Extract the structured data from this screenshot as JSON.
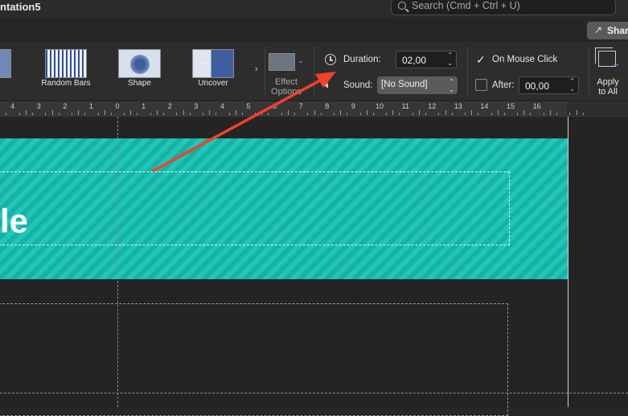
{
  "window": {
    "title": "ntation5"
  },
  "search": {
    "placeholder": "Search (Cmd + Ctrl + U)"
  },
  "share": {
    "label": "Shar"
  },
  "transitions": [
    {
      "label": ""
    },
    {
      "label": "Random Bars"
    },
    {
      "label": "Shape"
    },
    {
      "label": "Uncover"
    }
  ],
  "effect_options": {
    "label": "Effect Options"
  },
  "timing": {
    "duration_label": "Duration:",
    "duration_value": "02,00",
    "sound_label": "Sound:",
    "sound_value": "[No Sound]",
    "on_mouse_click_label": "On Mouse Click",
    "on_mouse_click_checked": true,
    "after_label": "After:",
    "after_value": "00,00",
    "after_checked": false
  },
  "apply": {
    "label": "Apply to All"
  },
  "ruler": {
    "labels": [
      "4",
      "3",
      "2",
      "1",
      "0",
      "1",
      "2",
      "3",
      "4",
      "5",
      "6",
      "7",
      "8",
      "9",
      "10",
      "11",
      "12",
      "13",
      "14",
      "15",
      "16"
    ]
  },
  "slide": {
    "title_fragment": "le"
  },
  "colors": {
    "band": "#1bbcb0",
    "arrow": "#f2412b"
  }
}
